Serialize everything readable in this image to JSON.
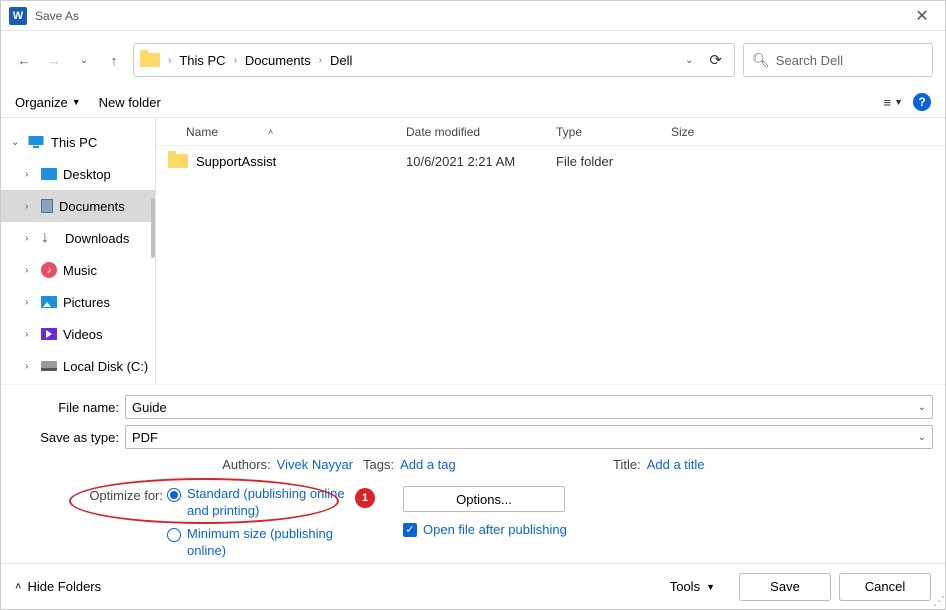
{
  "window": {
    "title": "Save As"
  },
  "breadcrumb": {
    "root": "This PC",
    "folder1": "Documents",
    "folder2": "Dell"
  },
  "search": {
    "placeholder": "Search Dell"
  },
  "toolbar": {
    "organize": "Organize",
    "newfolder": "New folder"
  },
  "sidebar": {
    "thispc": "This PC",
    "items": [
      {
        "label": "Desktop"
      },
      {
        "label": "Documents"
      },
      {
        "label": "Downloads"
      },
      {
        "label": "Music"
      },
      {
        "label": "Pictures"
      },
      {
        "label": "Videos"
      },
      {
        "label": "Local Disk (C:)"
      }
    ]
  },
  "columns": {
    "name": "Name",
    "date": "Date modified",
    "type": "Type",
    "size": "Size"
  },
  "rows": [
    {
      "name": "SupportAssist",
      "date": "10/6/2021 2:21 AM",
      "type": "File folder",
      "size": ""
    }
  ],
  "form": {
    "filename_label": "File name:",
    "filename_value": "Guide",
    "savetype_label": "Save as type:",
    "savetype_value": "PDF",
    "authors_label": "Authors:",
    "authors_value": "Vivek Nayyar",
    "tags_label": "Tags:",
    "tags_value": "Add a tag",
    "title_label": "Title:",
    "title_value": "Add a title",
    "optimize_label": "Optimize for:",
    "radio_standard": "Standard (publishing online and printing)",
    "radio_minimum": "Minimum size (publishing online)",
    "options_button": "Options...",
    "open_after": "Open file after publishing",
    "badge": "1"
  },
  "footer": {
    "hide": "Hide Folders",
    "tools": "Tools",
    "save": "Save",
    "cancel": "Cancel"
  }
}
